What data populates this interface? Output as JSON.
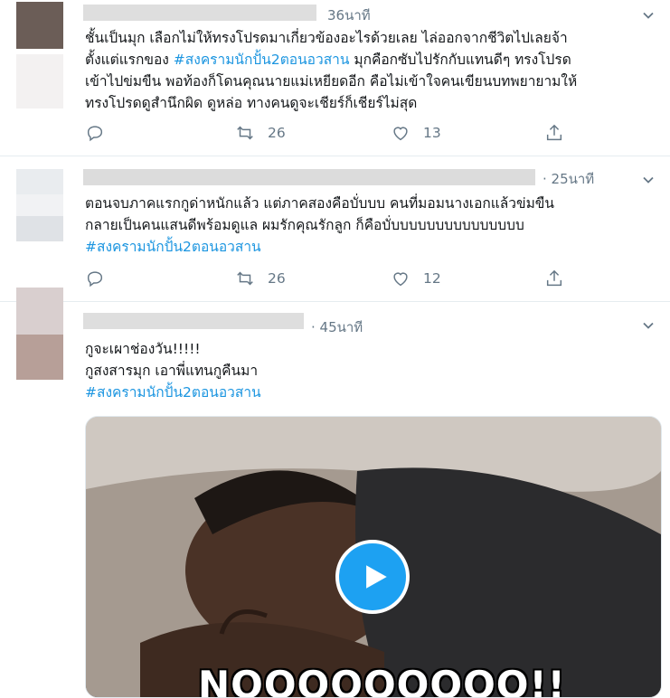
{
  "tweets": [
    {
      "time": "36นาที",
      "lines": [
        {
          "pre": "ชั้นเป็นมุก เลือกไม่ให้ทรงโปรดมาเกี่ยวข้องอะไรด้วยเลย ไล่ออกจากชีวิตไปเลยจ้า",
          "tag": "",
          "post": ""
        },
        {
          "pre": "ตั้งแต่แรกของ ",
          "tag": "#สงครามนักปั้น2ตอนอวสาน",
          "post": " มุกคือกซับไปรักกับแทนดีๆ ทรงโปรด"
        },
        {
          "pre": "เข้าไปข่มขืน พอท้องก็โดนคุณนายแม่เหยียดอีก คือไม่เข้าใจคนเขียนบทพยายามให้",
          "tag": "",
          "post": ""
        },
        {
          "pre": "ทรงโปรดดูสำนึกผิด ดูหล่อ ทางคนดูจะเชียร์ก็เชียร์ไม่สุด",
          "tag": "",
          "post": ""
        }
      ],
      "retweets": "26",
      "likes": "13"
    },
    {
      "time": "· 25นาที",
      "lines": [
        {
          "pre": "ตอนจบภาคแรกกูด่าหนักแล้ว แต่ภาคสองคือบั่บบบ คนที่มอมนางเอกแล้วข่มขืน",
          "tag": "",
          "post": ""
        },
        {
          "pre": "กลายเป็นคนแสนดีพร้อมดูแล ผมรักคุณรักลูก ก็คือบั่บบบบบบบบบบบบบบบ",
          "tag": "",
          "post": ""
        },
        {
          "pre": "",
          "tag": "#สงครามนักปั้น2ตอนอวสาน",
          "post": ""
        }
      ],
      "retweets": "26",
      "likes": "12"
    },
    {
      "time": "· 45นาที",
      "lines": [
        {
          "pre": "กูจะเผาช่องวัน!!!!!",
          "tag": "",
          "post": ""
        },
        {
          "pre": "กูสงสารมุก เอาพี่แทนกูคืนมา",
          "tag": "",
          "post": ""
        },
        {
          "pre": "",
          "tag": "#สงครามนักปั้น2ตอนอวสาน",
          "post": ""
        }
      ],
      "media_caption": "NOOOOOOOOO!!"
    }
  ],
  "icons": {
    "reply": "reply-icon",
    "retweet": "retweet-icon",
    "like": "heart-icon",
    "share": "share-icon",
    "caret": "chevron-down-icon",
    "play": "play-icon"
  },
  "colors": {
    "hashtag": "#1b95e0",
    "meta": "#657786",
    "play": "#1da1f2",
    "divider": "#e6ecf0"
  }
}
